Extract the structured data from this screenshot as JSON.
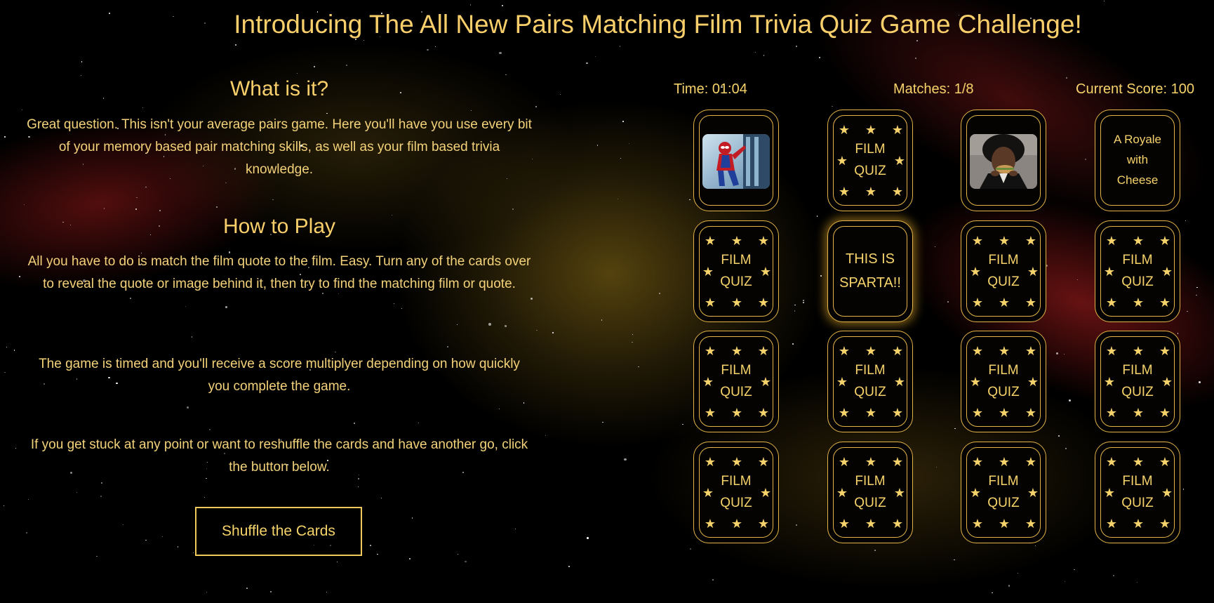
{
  "page": {
    "title": "Introducing The All New Pairs Matching Film Trivia Quiz Game Challenge!"
  },
  "info": {
    "what_heading": "What is it?",
    "what_text": "Great question. This isn't your average pairs game. Here you'll have you use every bit of your memory based pair matching skills, as well as your film based trivia knowledge.",
    "how_heading": "How to Play",
    "how_text": "All you have to do is match the film quote to the film. Easy. Turn any of the cards over to reveal the quote or image behind it, then try to find the matching film or quote.",
    "timed_text": "The game is timed and you'll receive a score multiplyer depending on how quickly you complete the game.",
    "stuck_text": "If you get stuck at any point or want to reshuffle the cards and have another go, click the button below.",
    "shuffle_label": "Shuffle the Cards"
  },
  "stats": {
    "time": "Time: 01:04",
    "matches": "Matches: 1/8",
    "score": "Current Score: 100"
  },
  "card_back": {
    "line1": "FILM",
    "line2": "QUIZ"
  },
  "cards": [
    {
      "state": "revealed-image",
      "image": "spiderman-image"
    },
    {
      "state": "hidden"
    },
    {
      "state": "revealed-image",
      "image": "pulp-fiction-image"
    },
    {
      "state": "revealed-quote",
      "quote": [
        "A Royale",
        "with",
        "Cheese"
      ]
    },
    {
      "state": "hidden"
    },
    {
      "state": "revealed-quote",
      "quote": [
        "THIS IS",
        "SPARTA!!"
      ],
      "highlight": true
    },
    {
      "state": "hidden"
    },
    {
      "state": "hidden"
    },
    {
      "state": "hidden"
    },
    {
      "state": "hidden"
    },
    {
      "state": "hidden"
    },
    {
      "state": "hidden"
    },
    {
      "state": "hidden"
    },
    {
      "state": "hidden"
    },
    {
      "state": "hidden"
    },
    {
      "state": "hidden"
    }
  ],
  "colors": {
    "accent": "#f6d36a",
    "card_border": "#e3b447",
    "background": "#000000"
  }
}
